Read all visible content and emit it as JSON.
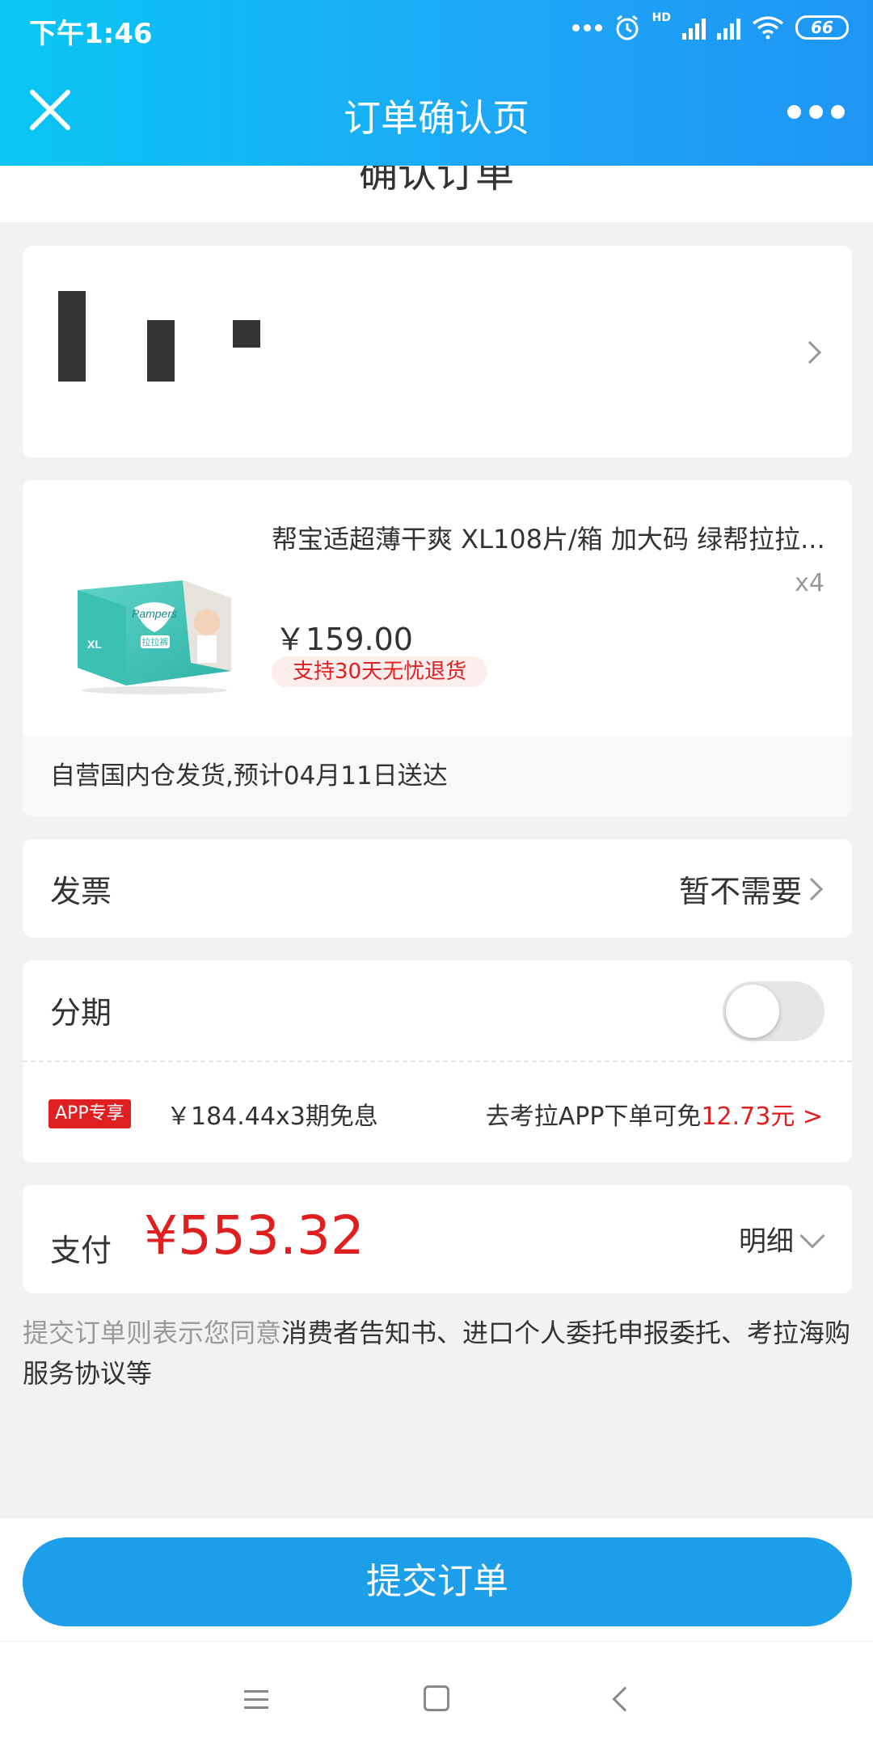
{
  "status_bar": {
    "time": "下午1:46",
    "network": "HD",
    "battery": "66"
  },
  "header": {
    "title": "订单确认页",
    "close_icon": "close-icon",
    "more_icon": "more-icon"
  },
  "page": {
    "section_title": "确认订单"
  },
  "product": {
    "name": "帮宝适超薄干爽 XL108片/箱 加大码 绿帮拉拉...",
    "quantity": "x4",
    "price": "￥159.00",
    "return_policy": "支持30天无忧退货",
    "image_brand": "Pampers",
    "image_size": "XL",
    "image_type": "拉拉裤",
    "shipping": "自营国内仓发货,预计04月11日送达"
  },
  "invoice": {
    "label": "发票",
    "value": "暂不需要"
  },
  "installment": {
    "label": "分期",
    "enabled": false,
    "app_badge": "APP专享",
    "plan": "￥184.44x3期免息",
    "promo_prefix": "去考拉APP下单可免",
    "promo_amount": "12.73元 >"
  },
  "payment": {
    "label": "支付",
    "amount": "¥553.32",
    "detail": "明细"
  },
  "agreement": {
    "prefix": "提交订单则表示您同意",
    "links": "消费者告知书、进口个人委托申报委托、考拉海购服务协议等"
  },
  "submit": {
    "label": "提交订单"
  },
  "colors": {
    "header_start": "#09c6f4",
    "header_end": "#1e95f5",
    "accent_red": "#e02020",
    "submit_blue": "#1d9ee8",
    "background": "#f2f2f2"
  }
}
